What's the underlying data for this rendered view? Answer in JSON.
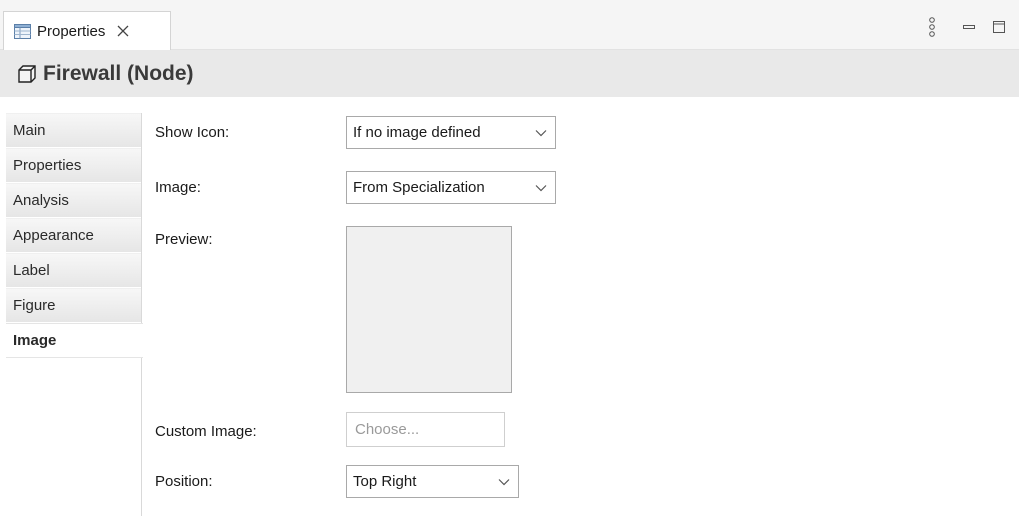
{
  "tab": {
    "label": "Properties",
    "icon": "properties-table-icon"
  },
  "view_controls": {
    "menu_icon": "view-menu-icon",
    "minimize_icon": "minimize-icon",
    "maximize_icon": "maximize-icon"
  },
  "header": {
    "title": "Firewall (Node)",
    "icon": "node-cube-icon"
  },
  "sidebar": {
    "items": [
      {
        "label": "Main"
      },
      {
        "label": "Properties"
      },
      {
        "label": "Analysis"
      },
      {
        "label": "Appearance"
      },
      {
        "label": "Label"
      },
      {
        "label": "Figure"
      },
      {
        "label": "Image",
        "selected": true
      }
    ]
  },
  "form": {
    "show_icon": {
      "label": "Show Icon:",
      "value": "If no image defined"
    },
    "image": {
      "label": "Image:",
      "value": "From Specialization"
    },
    "preview": {
      "label": "Preview:"
    },
    "custom_image": {
      "label": "Custom Image:",
      "button": "Choose..."
    },
    "position": {
      "label": "Position:",
      "value": "Top Right"
    }
  }
}
